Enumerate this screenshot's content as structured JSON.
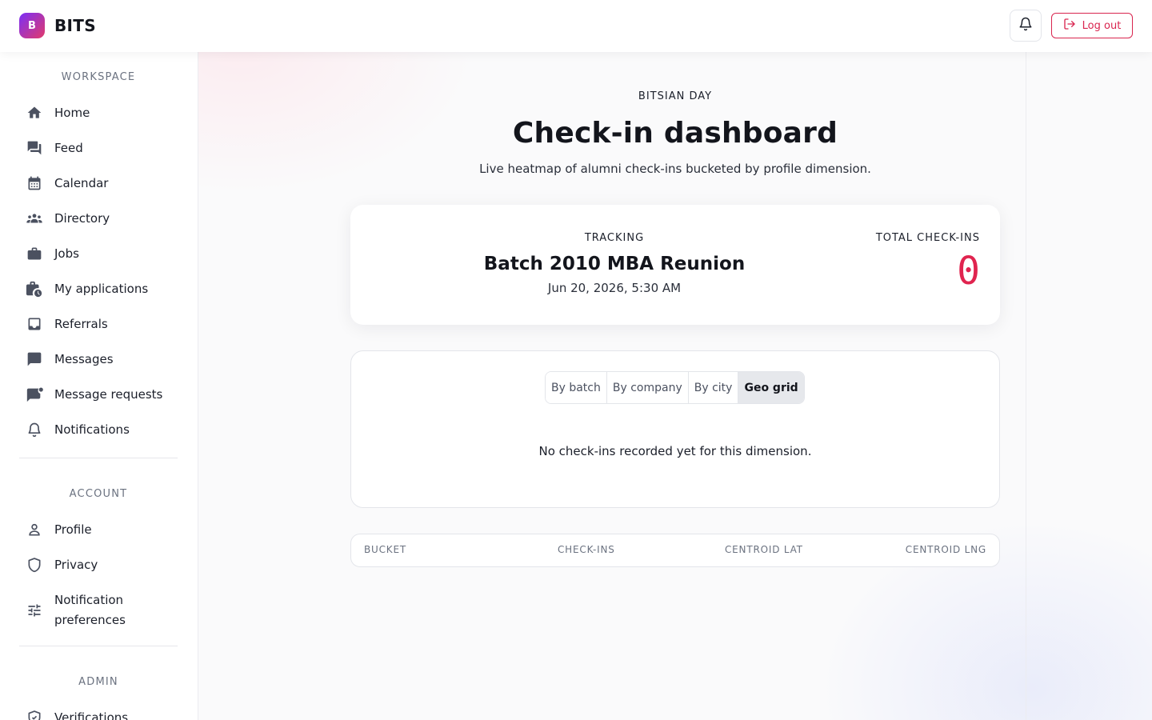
{
  "app": {
    "logo_letter": "B",
    "name": "BITS",
    "logout_label": "Log out"
  },
  "sidebar": {
    "workspace_label": "WORKSPACE",
    "workspace_items": [
      {
        "label": "Home",
        "icon": "home-icon"
      },
      {
        "label": "Feed",
        "icon": "forum-icon"
      },
      {
        "label": "Calendar",
        "icon": "calendar-icon"
      },
      {
        "label": "Directory",
        "icon": "people-icon"
      },
      {
        "label": "Jobs",
        "icon": "briefcase-icon"
      },
      {
        "label": "My applications",
        "icon": "briefcase-clock-icon"
      },
      {
        "label": "Referrals",
        "icon": "inbox-icon"
      },
      {
        "label": "Messages",
        "icon": "chat-icon"
      },
      {
        "label": "Message requests",
        "icon": "chat-badge-icon"
      },
      {
        "label": "Notifications",
        "icon": "bell-icon"
      }
    ],
    "account_label": "ACCOUNT",
    "account_items": [
      {
        "label": "Profile",
        "icon": "person-icon"
      },
      {
        "label": "Privacy",
        "icon": "shield-icon"
      },
      {
        "label": "Notification preferences",
        "icon": "sliders-icon"
      }
    ],
    "admin_label": "ADMIN",
    "admin_items": [
      {
        "label": "Verifications",
        "icon": "shield-check-icon"
      }
    ]
  },
  "page": {
    "eyebrow": "BITSIAN DAY",
    "title": "Check-in dashboard",
    "subtitle": "Live heatmap of alumni check-ins bucketed by profile dimension."
  },
  "tracking": {
    "label": "TRACKING",
    "event_name": "Batch 2010 MBA Reunion",
    "event_date": "Jun 20, 2026, 5:30 AM",
    "total_label": "TOTAL CHECK-INS",
    "total_value": "0",
    "total_color": "#e0244f"
  },
  "dimensions": {
    "tabs": [
      "By batch",
      "By company",
      "By city",
      "Geo grid"
    ],
    "selected": "Geo grid",
    "empty_message": "No check-ins recorded yet for this dimension."
  },
  "table": {
    "columns": [
      "BUCKET",
      "CHECK-INS",
      "CENTROID LAT",
      "CENTROID LNG"
    ]
  },
  "colors": {
    "accent": "#e0244f",
    "brand_gradient_start": "#7b2ff7",
    "brand_gradient_end": "#e23a6b"
  }
}
